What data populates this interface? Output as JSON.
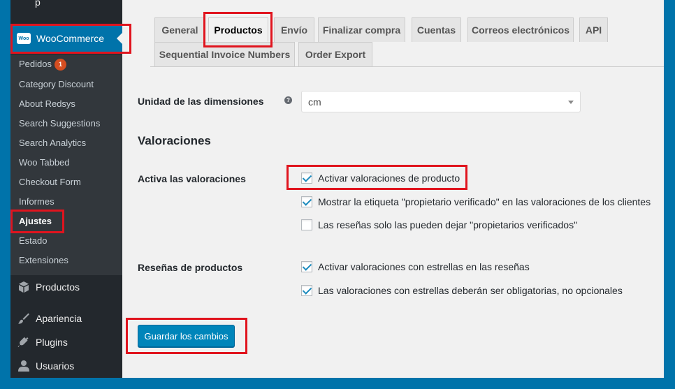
{
  "sidebar": {
    "top_fragment": "p",
    "woocommerce_label": "WooCommerce",
    "woocommerce_logo_text": "Woo",
    "submenu": [
      {
        "label": "Pedidos",
        "badge": "1"
      },
      {
        "label": "Category Discount"
      },
      {
        "label": "About Redsys"
      },
      {
        "label": "Search Suggestions"
      },
      {
        "label": "Search Analytics"
      },
      {
        "label": "Woo Tabbed"
      },
      {
        "label": "Checkout Form"
      },
      {
        "label": "Informes"
      },
      {
        "label": "Ajustes",
        "current": true
      },
      {
        "label": "Estado"
      },
      {
        "label": "Extensiones"
      }
    ],
    "menu": [
      {
        "label": "Productos",
        "icon": "box-icon"
      },
      {
        "label": "Apariencia",
        "icon": "paintbrush-icon"
      },
      {
        "label": "Plugins",
        "icon": "plug-icon"
      },
      {
        "label": "Usuarios",
        "icon": "user-icon"
      }
    ]
  },
  "tabs": [
    {
      "label": "General"
    },
    {
      "label": "Productos",
      "active": true
    },
    {
      "label": "Envío"
    },
    {
      "label": "Finalizar compra"
    },
    {
      "label": "Cuentas"
    },
    {
      "label": "Correos electrónicos"
    },
    {
      "label": "API"
    },
    {
      "label": "Sequential Invoice Numbers"
    },
    {
      "label": "Order Export"
    }
  ],
  "form": {
    "dimension_unit_label": "Unidad de las dimensiones",
    "help_icon_glyph": "?",
    "dimension_unit_value": "cm",
    "ratings_section_title": "Valoraciones",
    "enable_ratings_label": "Activa las valoraciones",
    "enable_ratings_options": [
      {
        "label": "Activar valoraciones de producto",
        "checked": true
      },
      {
        "label": "Mostrar la etiqueta \"propietario verificado\" en las valoraciones de los clientes",
        "checked": true
      },
      {
        "label": "Las reseñas solo las pueden dejar \"propietarios verificados\"",
        "checked": false
      }
    ],
    "product_reviews_label": "Reseñas de productos",
    "product_reviews_options": [
      {
        "label": "Activar valoraciones con estrellas en las reseñas",
        "checked": true
      },
      {
        "label": "Las valoraciones con estrellas deberán ser obligatorias, no opcionales",
        "checked": true
      }
    ],
    "save_button_label": "Guardar los cambios"
  },
  "colors": {
    "admin_blue": "#0073aa",
    "sidebar_dark": "#23282d",
    "highlight_red": "#e0141e",
    "primary_button": "#0085ba"
  }
}
